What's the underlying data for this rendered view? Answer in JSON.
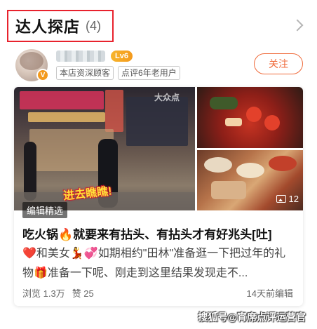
{
  "section": {
    "title": "达人探店",
    "count": "(4)"
  },
  "author": {
    "level_badge": "Lv6",
    "avatar_badge": "V",
    "tags": [
      "本店资深顾客",
      "点评6年老用户"
    ],
    "follow_label": "关注"
  },
  "card": {
    "editor_badge": "编辑精选",
    "photo_count": "12",
    "sticker_text": "进去瞧瞧!",
    "photo_watermark": "大众点",
    "title": "吃火锅🔥就要来有拈头、有拈头才有好兆头[吐]",
    "excerpt": "❤️和美女💃💞如期相约\"田林\"准备逛一下把过年的礼物🎁准备一下呢、刚走到这里结果发现走不...",
    "views": "浏览 1.3万",
    "likes": "赞 25",
    "time": "14天前编辑"
  },
  "source_watermark": "搜狐号@宵席点评运营官",
  "colors": {
    "accent": "#ef6a3a",
    "highlight_border": "#e8222d",
    "level": "#f49a1d"
  }
}
